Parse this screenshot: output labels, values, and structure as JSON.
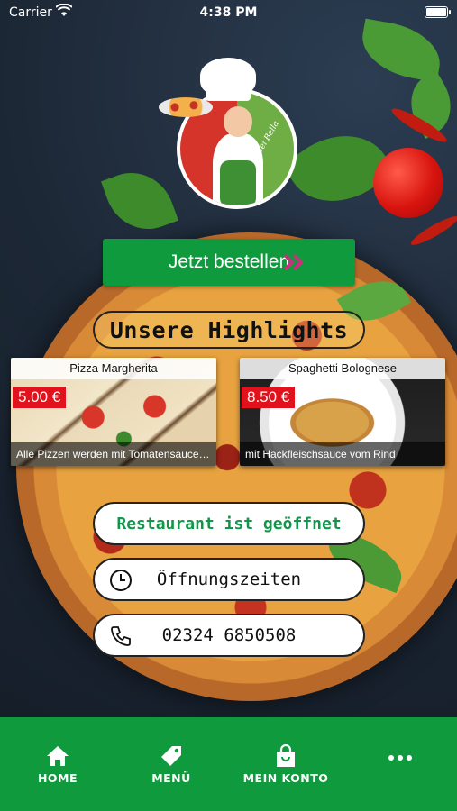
{
  "status_bar": {
    "carrier": "Carrier",
    "time": "4:38 PM",
    "battery_level": 1.0
  },
  "logo": {
    "script_text": "Bei Bella"
  },
  "order_button": {
    "label": "Jetzt bestellen"
  },
  "highlights": {
    "title": "Unsere Highlights",
    "items": [
      {
        "name": "Pizza Margherita",
        "price": "5.00 €",
        "description": "Alle Pizzen werden mit Tomatensauce u..."
      },
      {
        "name": "Spaghetti Bolognese",
        "price": "8.50 €",
        "description": "mit Hackfleischsauce vom Rind"
      }
    ]
  },
  "info": {
    "status": "Restaurant ist geöffnet",
    "hours_label": "Öffnungszeiten",
    "phone": "02324 6850508"
  },
  "tabbar": {
    "home": "HOME",
    "menu": "MENÜ",
    "account": "MEIN KONTO"
  },
  "colors": {
    "brand_green": "#0f9a3e",
    "price_red": "#e1121b",
    "open_text": "#13964a"
  }
}
